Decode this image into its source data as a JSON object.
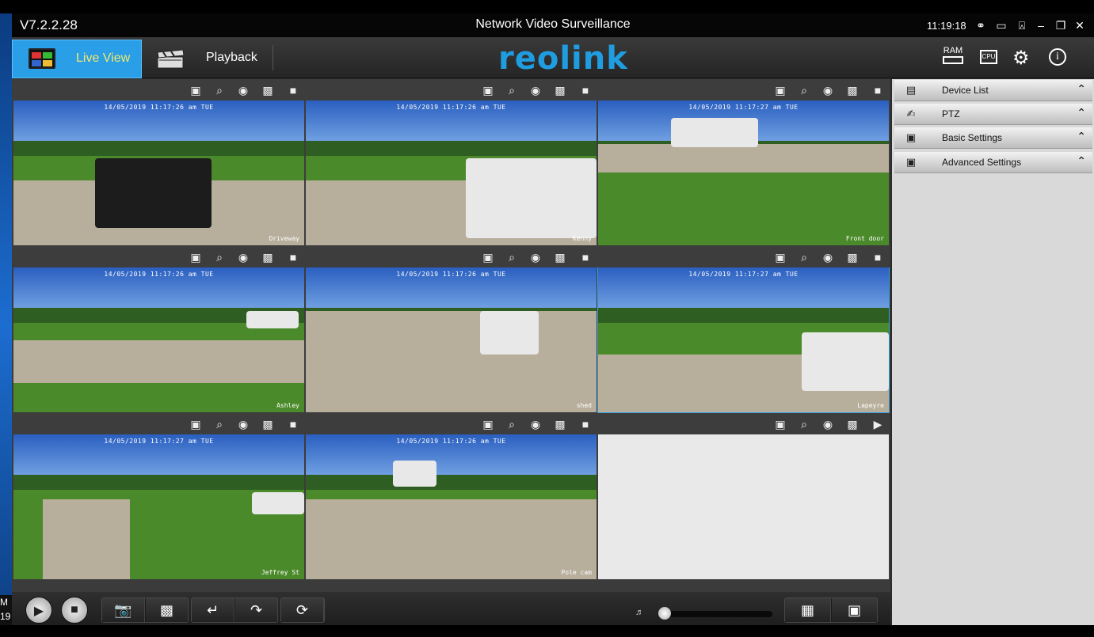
{
  "taskbar": {
    "time_fragment": "M",
    "date_fragment": "19"
  },
  "titlebar": {
    "version": "V7.2.2.28",
    "title": "Network Video Surveillance",
    "clock": "11:19:18"
  },
  "nav": {
    "live_label": "Live View",
    "playback_label": "Playback",
    "logo": "reolink",
    "ram_label": "RAM",
    "cpu_label": "CPU"
  },
  "colors": {
    "accent": "#2a9ee6",
    "live_text": "#f2e96b",
    "logo": "#1f9de0"
  },
  "cameras": [
    {
      "timestamp": "14/05/2019 11:17:26 am TUE",
      "name": "Driveway"
    },
    {
      "timestamp": "14/05/2019 11:17:26 am TUE",
      "name": "Kenny"
    },
    {
      "timestamp": "14/05/2019 11:17:27 am TUE",
      "name": "Front door"
    },
    {
      "timestamp": "14/05/2019 11:17:26 am TUE",
      "name": "Ashley"
    },
    {
      "timestamp": "14/05/2019 11:17:26 am TUE",
      "name": "shed"
    },
    {
      "timestamp": "14/05/2019 11:17:27 am TUE",
      "name": "Lapeyre"
    },
    {
      "timestamp": "14/05/2019 11:17:27 am TUE",
      "name": "Jeffrey St"
    },
    {
      "timestamp": "14/05/2019 11:17:26 am TUE",
      "name": "Pole cam"
    },
    {
      "timestamp": "",
      "name": ""
    }
  ],
  "side_panel": [
    {
      "label": "Device List",
      "icon": "device-icon"
    },
    {
      "label": "PTZ",
      "icon": "ptz-icon"
    },
    {
      "label": "Basic Settings",
      "icon": "camera-settings-icon"
    },
    {
      "label": "Advanced Settings",
      "icon": "camera-advanced-icon"
    }
  ],
  "toolbar": {
    "icons": [
      "play-icon",
      "stop-icon",
      "snapshot-icon",
      "record-icon",
      "prev-page-icon",
      "next-page-icon",
      "cycle-icon",
      "speaker-icon",
      "layout-icon",
      "fullscreen-icon"
    ],
    "volume": 0
  }
}
